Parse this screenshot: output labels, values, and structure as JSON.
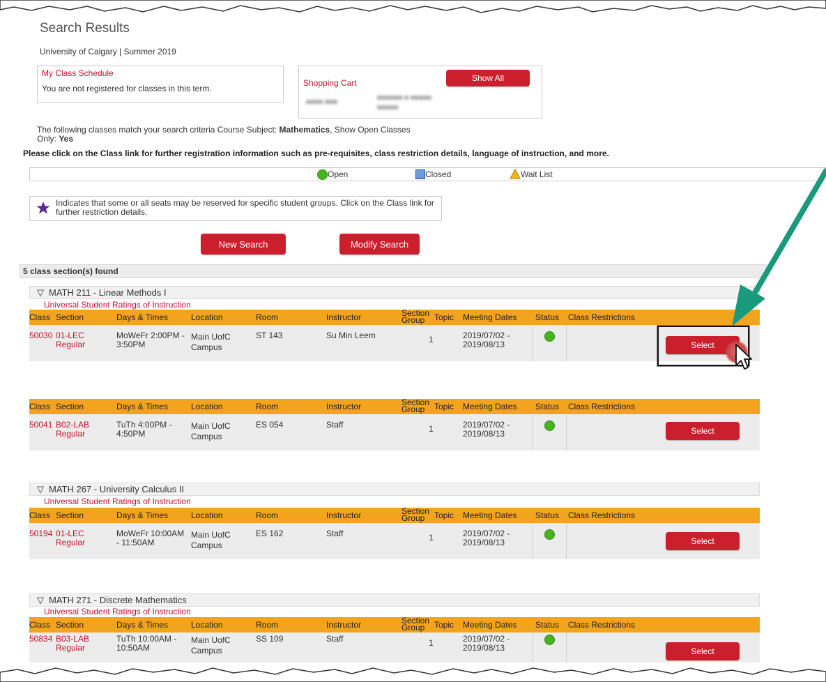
{
  "page": {
    "title": "Search Results",
    "term": "University of Calgary | Summer 2019"
  },
  "schedule": {
    "title": "My Class Schedule",
    "message": "You are not registered for classes in this term."
  },
  "cart": {
    "title": "Shopping Cart",
    "show_all": "Show All"
  },
  "criteria": {
    "prefix": "The following classes match your search criteria Course Subject: ",
    "subject": "Mathematics",
    "middle": ",  Show Open Classes",
    "only_label": "Only: ",
    "only_value": "Yes",
    "instruction": "Please click on the Class link for further registration information such as pre-requisites, class restriction details, language of instruction, and more."
  },
  "legend": {
    "open": "Open",
    "closed": "Closed",
    "waitlist": "Wait List",
    "colors": {
      "open": "#47b520",
      "closed": "#6b9bd8",
      "waitlist": "#f5b800"
    }
  },
  "reserved_note": "Indicates that some or all seats may be reserved for specific student groups. Click on the Class link for further restriction details.",
  "buttons": {
    "new_search": "New Search",
    "modify_search": "Modify Search",
    "select": "Select"
  },
  "found": "5 class section(s) found",
  "headers": {
    "class": "Class",
    "section": "Section",
    "days": "Days & Times",
    "location": "Location",
    "room": "Room",
    "instructor": "Instructor",
    "section_group_1": "Section",
    "section_group_2": "Group",
    "topic": "Topic",
    "dates": "Meeting Dates",
    "status": "Status",
    "restrictions": "Class Restrictions"
  },
  "ratings_link": "Universal Student Ratings of Instruction",
  "courses": [
    {
      "title": "MATH 211 - Linear Methods I"
    },
    {
      "title": "MATH 267 - University Calculus II"
    },
    {
      "title": "MATH 271 - Discrete Mathematics"
    }
  ],
  "sections": [
    {
      "class": "50030",
      "section": "01-LEC",
      "type": "Regular",
      "days1": "MoWeFr 2:00PM -",
      "days2": "3:50PM",
      "loc1": "Main UofC",
      "loc2": "Campus",
      "room": "ST 143",
      "instructor": "Su Min Leem",
      "group": "1",
      "dates1": "2019/07/02 -",
      "dates2": "2019/08/13"
    },
    {
      "class": "50041",
      "section": "B02-LAB",
      "type": "Regular",
      "days1": "TuTh 4:00PM -",
      "days2": "4:50PM",
      "loc1": "Main UofC",
      "loc2": "Campus",
      "room": "ES 054",
      "instructor": "Staff",
      "group": "1",
      "dates1": "2019/07/02 -",
      "dates2": "2019/08/13"
    },
    {
      "class": "50194",
      "section": "01-LEC",
      "type": "Regular",
      "days1": "MoWeFr 10:00AM",
      "days2": "- 11:50AM",
      "loc1": "Main UofC",
      "loc2": "Campus",
      "room": "ES 162",
      "instructor": "Staff",
      "group": "1",
      "dates1": "2019/07/02 -",
      "dates2": "2019/08/13"
    },
    {
      "class": "50834",
      "section": "B03-LAB",
      "type": "Regular",
      "days1": "TuTh 10:00AM -",
      "days2": "10:50AM",
      "loc1": "Main UofC",
      "loc2": "Campus",
      "room": "SS 109",
      "instructor": "Staff",
      "group": "1",
      "dates1": "2019/07/02 -",
      "dates2": "2019/08/13"
    }
  ]
}
